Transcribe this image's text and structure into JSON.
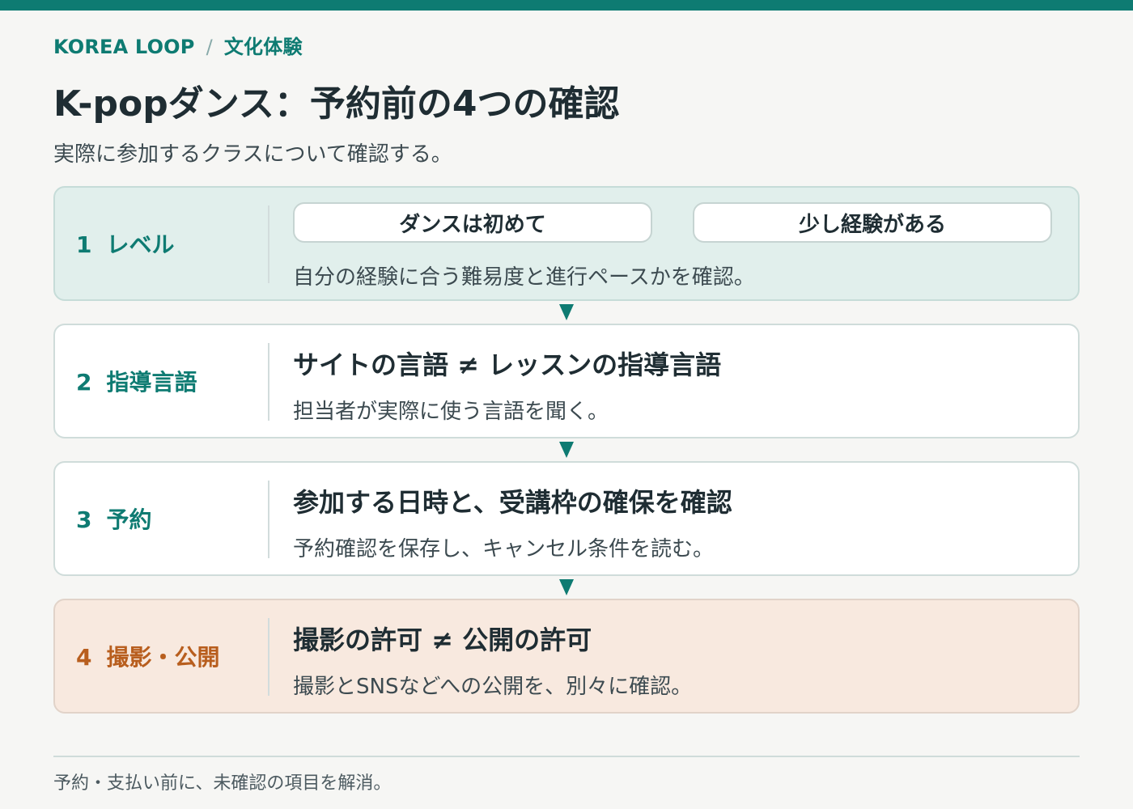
{
  "breadcrumb": {
    "site": "KOREA LOOP",
    "separator": "/",
    "section": "文化体験"
  },
  "title": "K-popダンス：予約前の4つの確認",
  "subtitle": "実際に参加するクラスについて確認する。",
  "steps": [
    {
      "number": "1",
      "label": "レベル",
      "options": [
        "ダンスは初めて",
        "少し経験がある"
      ],
      "description": "自分の経験に合う難易度と進行ペースかを確認。"
    },
    {
      "number": "2",
      "label": "指導言語",
      "heading": "サイトの言語 ≠ レッスンの指導言語",
      "description": "担当者が実際に使う言語を聞く。"
    },
    {
      "number": "3",
      "label": "予約",
      "heading": "参加する日時と、受講枠の確保を確認",
      "description": "予約確認を保存し、キャンセル条件を読む。"
    },
    {
      "number": "4",
      "label": "撮影・公開",
      "heading": "撮影の許可 ≠ 公開の許可",
      "description": "撮影とSNSなどへの公開を、別々に確認。"
    }
  ],
  "footer": "予約・支払い前に、未確認の項目を解消。",
  "colors": {
    "accent": "#0e7b72",
    "warning": "#b85e1e",
    "teal_bg": "#e1efec",
    "peach_bg": "#f8e9df"
  }
}
